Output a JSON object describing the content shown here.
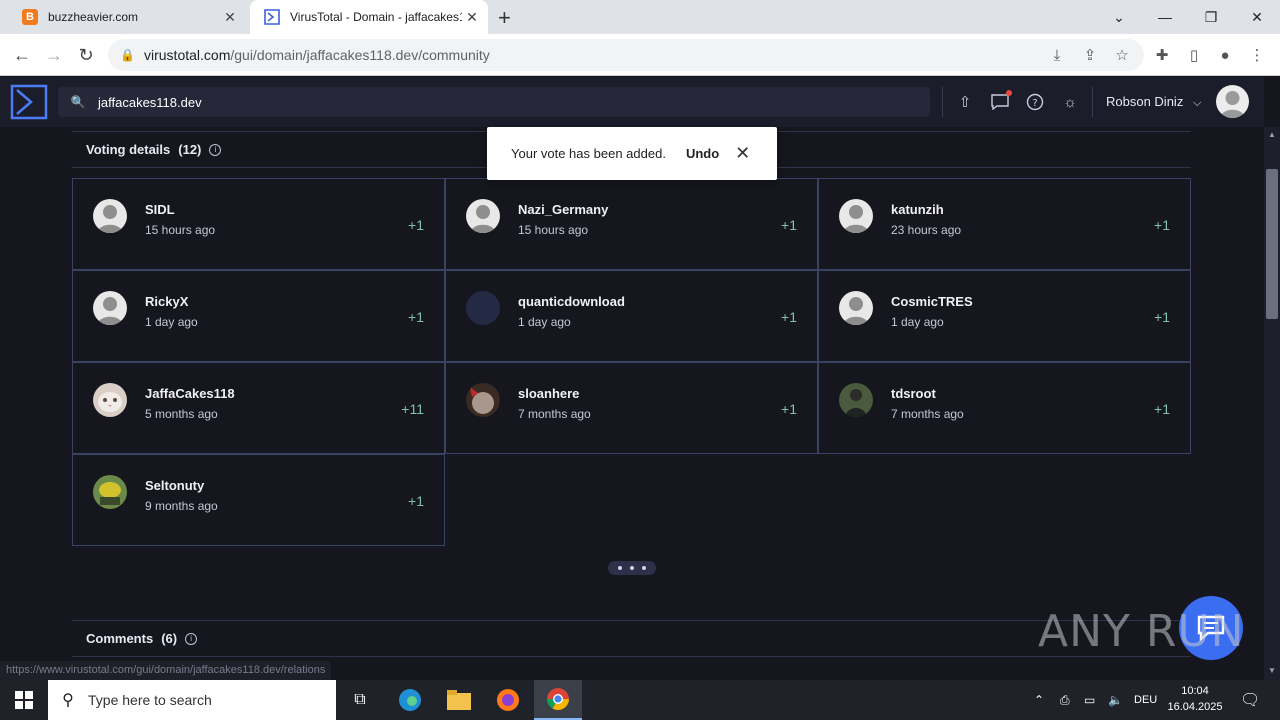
{
  "browser": {
    "tabs": [
      {
        "title": "buzzheavier.com",
        "favicon": "B"
      },
      {
        "title": "VirusTotal - Domain - jaffacakes1",
        "favicon": "vt-icon"
      }
    ],
    "url_host": "virustotal.com",
    "url_path": "/gui/domain/jaffacakes118.dev/community"
  },
  "vt": {
    "search_value": "jaffacakes118.dev",
    "user_name": "Robson Diniz"
  },
  "voting": {
    "title": "Voting details",
    "count": "(12)",
    "cards": [
      {
        "name": "SIDL",
        "time": "15 hours ago",
        "vote": "+1"
      },
      {
        "name": "Nazi_Germany",
        "time": "15 hours ago",
        "vote": "+1"
      },
      {
        "name": "katunzih",
        "time": "23 hours ago",
        "vote": "+1"
      },
      {
        "name": "RickyX",
        "time": "1 day ago",
        "vote": "+1"
      },
      {
        "name": "quanticdownload",
        "time": "1 day ago",
        "vote": "+1"
      },
      {
        "name": "CosmicTRES",
        "time": "1 day ago",
        "vote": "+1"
      },
      {
        "name": "JaffaCakes118",
        "time": "5 months ago",
        "vote": "+11"
      },
      {
        "name": "sloanhere",
        "time": "7 months ago",
        "vote": "+1"
      },
      {
        "name": "tdsroot",
        "time": "7 months ago",
        "vote": "+1"
      },
      {
        "name": "Seltonuty",
        "time": "9 months ago",
        "vote": "+1"
      }
    ]
  },
  "comments": {
    "title": "Comments",
    "count": "(6)"
  },
  "toast": {
    "message": "Your vote has been added.",
    "undo": "Undo"
  },
  "status_url": "https://www.virustotal.com/gui/domain/jaffacakes118.dev/relations",
  "watermark": "ANY RUN",
  "taskbar": {
    "search_placeholder": "Type here to search",
    "lang": "DEU",
    "time": "10:04",
    "date": "16.04.2025"
  }
}
